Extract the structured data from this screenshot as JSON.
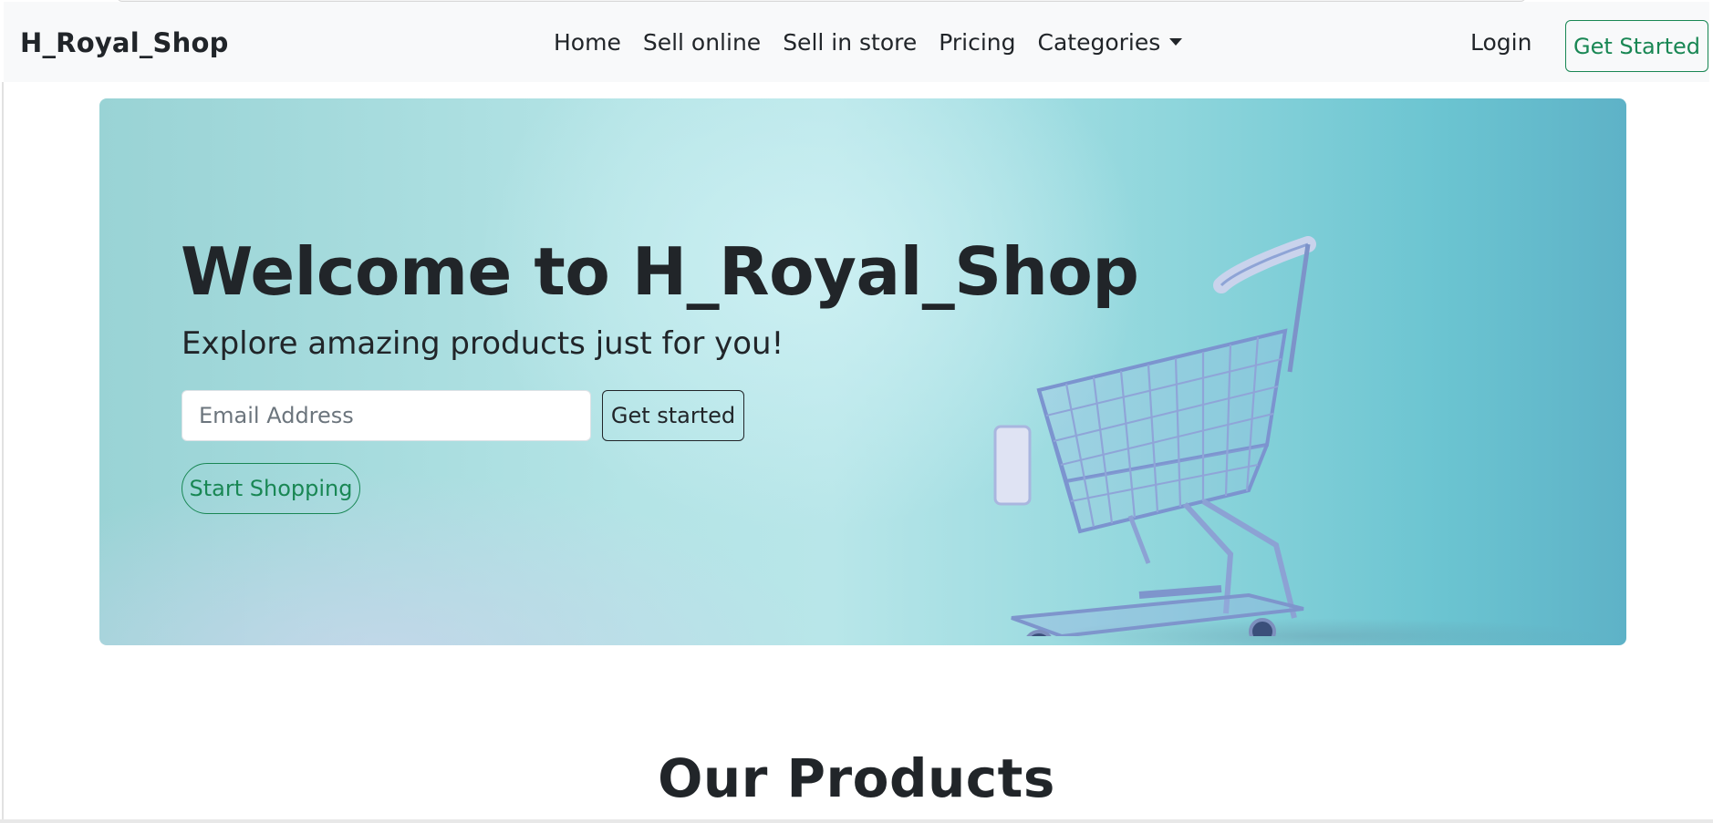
{
  "navbar": {
    "brand": "H_Royal_Shop",
    "links": [
      "Home",
      "Sell online",
      "Sell in store",
      "Pricing",
      "Categories"
    ],
    "login_label": "Login",
    "get_started_label": "Get Started"
  },
  "hero": {
    "title": "Welcome to H_Royal_Shop",
    "subtitle": "Explore amazing products just for you!",
    "email_placeholder": "Email Address",
    "get_started_label": "Get started",
    "start_shopping_label": "Start Shopping"
  },
  "products": {
    "heading": "Our Products"
  },
  "colors": {
    "accent_green": "#198754",
    "text_dark": "#212529",
    "navbar_bg": "#f8f9fa",
    "hero_teal": "#8fd6dc"
  },
  "icons": {
    "dropdown": "caret-down-icon",
    "hero_image": "shopping-cart-icon"
  }
}
